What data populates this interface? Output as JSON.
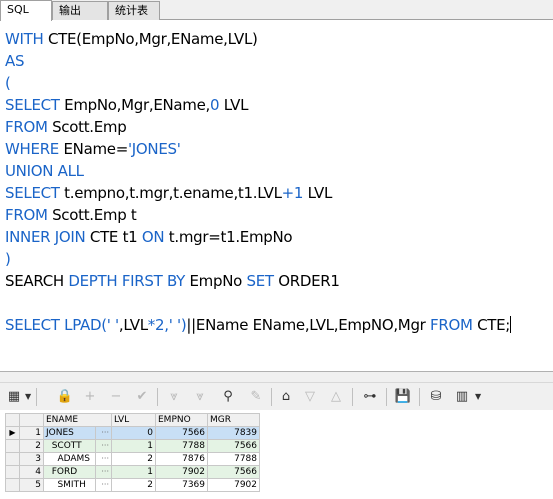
{
  "tabs": [
    {
      "label": "SQL",
      "active": true
    },
    {
      "label": "输出",
      "active": false
    },
    {
      "label": "统计表",
      "active": false
    }
  ],
  "editor": {
    "lines": [
      [
        {
          "t": "WITH ",
          "c": "kw"
        },
        {
          "t": "CTE(EmpNo,Mgr,EName,LVL)",
          "c": ""
        }
      ],
      [
        {
          "t": "AS",
          "c": "kw"
        }
      ],
      [
        {
          "t": "(",
          "c": "kw"
        }
      ],
      [
        {
          "t": "SELECT ",
          "c": "kw"
        },
        {
          "t": "EmpNo,Mgr,EName,",
          "c": ""
        },
        {
          "t": "0",
          "c": "num"
        },
        {
          "t": " LVL",
          "c": ""
        }
      ],
      [
        {
          "t": "FROM ",
          "c": "kw"
        },
        {
          "t": "Scott.Emp",
          "c": ""
        }
      ],
      [
        {
          "t": "WHERE ",
          "c": "kw"
        },
        {
          "t": "EName=",
          "c": ""
        },
        {
          "t": "'JONES'",
          "c": "str"
        }
      ],
      [
        {
          "t": "UNION ALL",
          "c": "kw"
        }
      ],
      [
        {
          "t": "SELECT ",
          "c": "kw"
        },
        {
          "t": "t.empno,t.mgr,t.ename,t1.LVL",
          "c": ""
        },
        {
          "t": "+1",
          "c": "num"
        },
        {
          "t": " LVL",
          "c": ""
        }
      ],
      [
        {
          "t": "FROM ",
          "c": "kw"
        },
        {
          "t": "Scott.Emp t",
          "c": ""
        }
      ],
      [
        {
          "t": "INNER JOIN ",
          "c": "kw"
        },
        {
          "t": "CTE t1 ",
          "c": ""
        },
        {
          "t": "ON ",
          "c": "kw"
        },
        {
          "t": "t.mgr=t1.EmpNo",
          "c": ""
        }
      ],
      [
        {
          "t": ")",
          "c": "kw"
        }
      ],
      [
        {
          "t": "SEARCH ",
          "c": ""
        },
        {
          "t": "DEPTH FIRST BY ",
          "c": "kw"
        },
        {
          "t": "EmpNo ",
          "c": ""
        },
        {
          "t": "SET ",
          "c": "kw"
        },
        {
          "t": "ORDER1",
          "c": ""
        }
      ],
      [],
      [
        {
          "t": "SELECT ",
          "c": "kw"
        },
        {
          "t": "LPAD(",
          "c": "kw"
        },
        {
          "t": "' '",
          "c": "str"
        },
        {
          "t": ",LVL",
          "c": ""
        },
        {
          "t": "*2,",
          "c": "num"
        },
        {
          "t": "' '",
          "c": "str"
        },
        {
          "t": ")",
          "c": "kw"
        },
        {
          "t": "||EName EName,LVL,EmpNO,Mgr ",
          "c": ""
        },
        {
          "t": "FROM ",
          "c": "kw"
        },
        {
          "t": "CTE;",
          "c": ""
        }
      ]
    ]
  },
  "toolbar": {
    "icons": [
      "grid-icon",
      "lock-icon",
      "add-icon",
      "remove-icon",
      "check-icon",
      "down-arrows-icon",
      "down-arrows-alt-icon",
      "binoculars-icon",
      "clear-icon",
      "export-icon",
      "triangle-down-icon",
      "triangle-up-icon",
      "tree-icon",
      "save-icon",
      "db-icon",
      "chart-icon"
    ]
  },
  "grid": {
    "columns": [
      "ENAME",
      "LVL",
      "EMPNO",
      "MGR"
    ],
    "rows": [
      {
        "n": "1",
        "ename": "JONES",
        "lvl": "0",
        "empno": "7566",
        "mgr": "7839"
      },
      {
        "n": "2",
        "ename": "  SCOTT",
        "lvl": "1",
        "empno": "7788",
        "mgr": "7566"
      },
      {
        "n": "3",
        "ename": "    ADAMS",
        "lvl": "2",
        "empno": "7876",
        "mgr": "7788"
      },
      {
        "n": "4",
        "ename": "  FORD",
        "lvl": "1",
        "empno": "7902",
        "mgr": "7566"
      },
      {
        "n": "5",
        "ename": "    SMITH",
        "lvl": "2",
        "empno": "7369",
        "mgr": "7902"
      }
    ],
    "ellipsis": "···",
    "current_row_marker": "▶"
  },
  "colors": {
    "keyword": "#1a64c8",
    "selected_row": "#c8dff5",
    "alt_row": "#e4f3e4"
  }
}
